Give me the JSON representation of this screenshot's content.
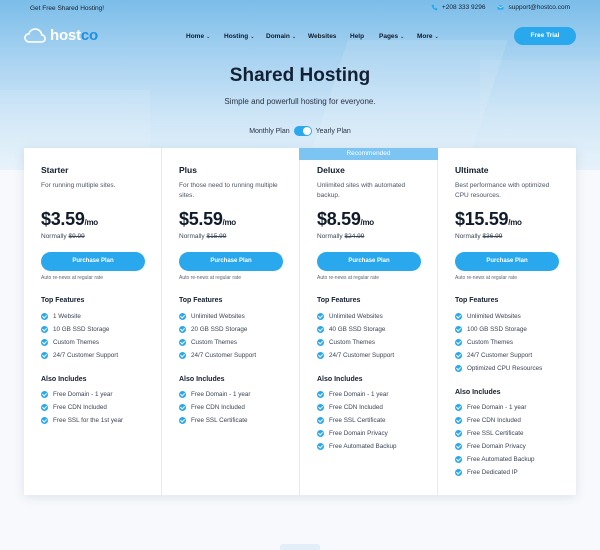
{
  "topbar": {
    "promo": "Get Free Shared Hosting!",
    "phone": "+208 333 9296",
    "email": "support@hostco.com"
  },
  "brand": {
    "name_a": "host",
    "name_b": "co"
  },
  "nav": {
    "items": [
      "Home",
      "Hosting",
      "Domain",
      "Websites",
      "Help",
      "Pages",
      "More"
    ],
    "cta": "Free Trial"
  },
  "hero": {
    "title": "Shared Hosting",
    "subtitle": "Simple and powerfull hosting for everyone.",
    "monthly": "Monthly Plan",
    "yearly": "Yearly Plan"
  },
  "recommended": "Recommended",
  "colors": {
    "accent": "#2aa8ee",
    "recommended": "#7cc4f1"
  },
  "plans": [
    {
      "name": "Starter",
      "desc": "For running multiple sites.",
      "price": "$3.59",
      "per": "/mo",
      "normally_label": "Normally",
      "normally_price": "$9.99",
      "button": "Purchase Plan",
      "renew": "Auto re-news at regular rate",
      "top_title": "Top Features",
      "top": [
        "1 Website",
        "10 GB SSD Storage",
        "Custom Themes",
        "24/7 Customer Support"
      ],
      "also_title": "Also Includes",
      "also": [
        "Free Domain - 1 year",
        "Free CDN Included",
        "Free SSL for the 1st year"
      ]
    },
    {
      "name": "Plus",
      "desc": "For those need to running multiple sites.",
      "price": "$5.59",
      "per": "/mo",
      "normally_label": "Normally",
      "normally_price": "$15.99",
      "button": "Purchase Plan",
      "renew": "Auto re-news at regular rate",
      "top_title": "Top Features",
      "top": [
        "Unlimited Websites",
        "20 GB SSD Storage",
        "Custom Themes",
        "24/7 Customer Support"
      ],
      "also_title": "Also Includes",
      "also": [
        "Free Domain - 1 year",
        "Free CDN Included",
        "Free SSL Certificate"
      ]
    },
    {
      "name": "Deluxe",
      "desc": "Unlimited sites with automated backup.",
      "price": "$8.59",
      "per": "/mo",
      "normally_label": "Normally",
      "normally_price": "$24.99",
      "button": "Purchase Plan",
      "renew": "Auto re-news at regular rate",
      "top_title": "Top Features",
      "top": [
        "Unlimited Websites",
        "40 GB SSD Storage",
        "Custom Themes",
        "24/7 Customer Support"
      ],
      "also_title": "Also Includes",
      "also": [
        "Free Domain - 1 year",
        "Free CDN Included",
        "Free SSL Certificate",
        "Free Domain Privacy",
        "Free Automated Backup"
      ]
    },
    {
      "name": "Ultimate",
      "desc": "Best performance with optimized CPU resources.",
      "price": "$15.59",
      "per": "/mo",
      "normally_label": "Normally",
      "normally_price": "$36.99",
      "button": "Purchase Plan",
      "renew": "Auto re-news at regular rate",
      "top_title": "Top Features",
      "top": [
        "Unlimited Websites",
        "100 GB SSD Storage",
        "Custom Themes",
        "24/7 Customer Support",
        "Optimized CPU Resources"
      ],
      "also_title": "Also Includes",
      "also": [
        "Free Domain - 1 year",
        "Free CDN Included",
        "Free SSL Certificate",
        "Free Domain Privacy",
        "Free Automated Backup",
        "Free Dedicated IP"
      ]
    }
  ]
}
